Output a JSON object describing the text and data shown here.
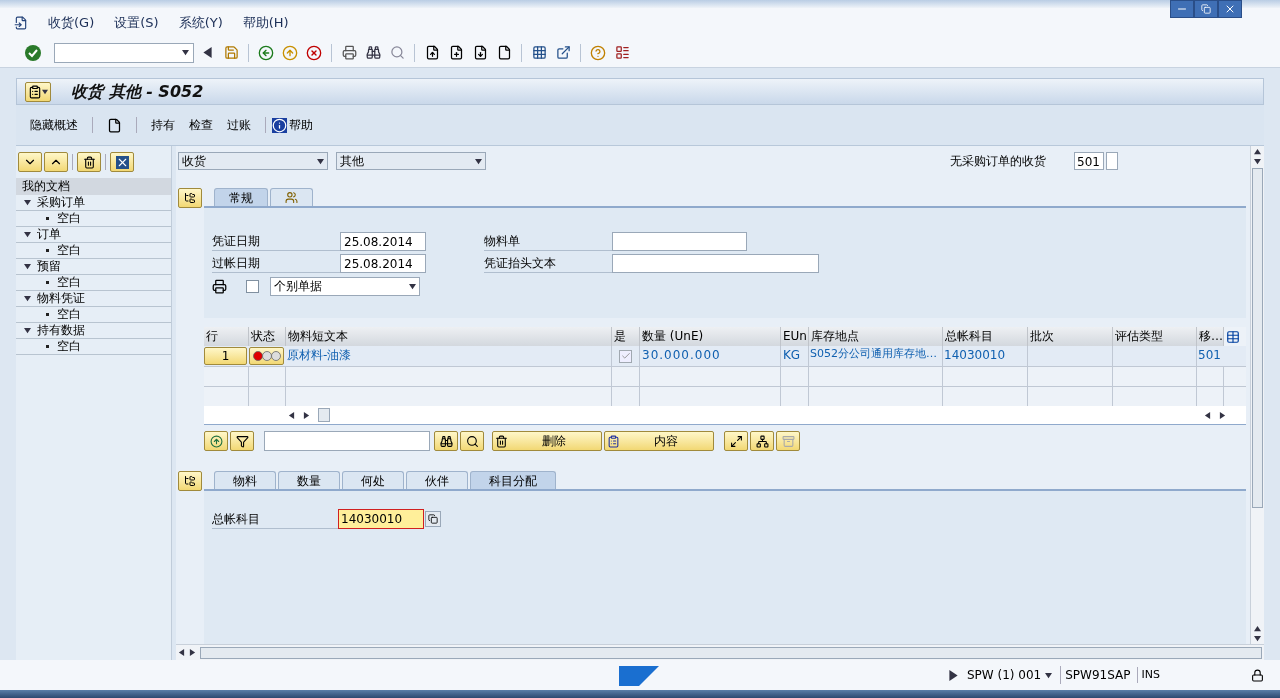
{
  "menu": [
    {
      "label": "收货(G)"
    },
    {
      "label": "设置(S)"
    },
    {
      "label": "系统(Y)"
    },
    {
      "label": "帮助(H)"
    }
  ],
  "title": "收货 其他 - S052",
  "app_toolbar": [
    {
      "kind": "text",
      "label": "隐藏概述"
    },
    {
      "kind": "icon"
    },
    {
      "kind": "text",
      "label": "持有"
    },
    {
      "kind": "text",
      "label": "检查"
    },
    {
      "kind": "text",
      "label": "过账"
    },
    {
      "kind": "info",
      "label": "帮助"
    }
  ],
  "sidebar": {
    "heading": "我的文档",
    "items": [
      {
        "label": "采购订单",
        "expanded": true,
        "children": [
          {
            "label": "空白"
          }
        ]
      },
      {
        "label": "订单",
        "expanded": true,
        "children": [
          {
            "label": "空白"
          }
        ]
      },
      {
        "label": "预留",
        "expanded": true,
        "children": [
          {
            "label": "空白"
          }
        ]
      },
      {
        "label": "物料凭证",
        "expanded": true,
        "children": [
          {
            "label": "空白"
          }
        ]
      },
      {
        "label": "持有数据",
        "expanded": true,
        "children": [
          {
            "label": "空白"
          }
        ]
      }
    ]
  },
  "header": {
    "transaction": "收货",
    "reference": "其他",
    "movement_label": "无采购订单的收货",
    "movement_type": "501"
  },
  "header_tabs": [
    {
      "kind": "text",
      "label": "常规",
      "selected": true
    },
    {
      "kind": "icon",
      "selected": false
    }
  ],
  "general": {
    "fields": [
      {
        "label": "凭证日期",
        "value": "25.08.2014"
      },
      {
        "label": "过帐日期",
        "value": "25.08.2014"
      },
      {
        "label": "物料单"
      },
      {
        "label": "凭证抬头文本"
      }
    ],
    "print_checked": false,
    "print_option": "个别单据"
  },
  "table": {
    "columns": [
      "行",
      "状态",
      "物料短文本",
      "是",
      "数量 (UnE)",
      "EUn",
      "库存地点",
      "总帐科目",
      "批次",
      "评估类型",
      "移…"
    ],
    "rows": [
      {
        "line": "1",
        "error": true,
        "text": "原材料-油漆",
        "ok_checked": true,
        "quantity": "30.000.000",
        "unit": "KG",
        "storage_location": "S052分公司通用库存地…",
        "gl_account": "14030010",
        "movement_type": "501"
      }
    ]
  },
  "table_buttons": [
    {
      "label": "删除"
    },
    {
      "label": "内容"
    }
  ],
  "item_tabs": [
    {
      "label": "物料",
      "selected": false
    },
    {
      "label": "数量",
      "selected": false
    },
    {
      "label": "何处",
      "selected": false
    },
    {
      "label": "伙伴",
      "selected": false
    },
    {
      "label": "科目分配",
      "selected": true
    }
  ],
  "account": {
    "label": "总帐科目",
    "value": "14030010"
  },
  "status_bar": {
    "system": "SPW (1) 001",
    "server": "SPW91SAP",
    "mode": "INS"
  }
}
